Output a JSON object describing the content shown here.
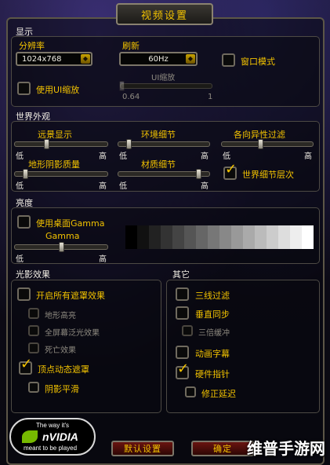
{
  "window": {
    "title": "视频设置"
  },
  "display": {
    "section_label": "显示",
    "resolution_label": "分辨率",
    "resolution_value": "1024x768",
    "refresh_label": "刷新",
    "refresh_value": "60Hz",
    "window_mode_label": "窗口模式",
    "window_mode_checked": false,
    "ui_scale_label": "使用UI缩放",
    "ui_scale_checked": false,
    "ui_scale_slider_label": "UI缩放",
    "ui_scale_min": "0.64",
    "ui_scale_max": "1",
    "ui_scale_level": 0.0
  },
  "world": {
    "section_label": "世界外观",
    "low_label": "低",
    "high_label": "高",
    "view_distance_label": "远景显示",
    "view_distance_level": 0.33,
    "environment_detail_label": "环境细节",
    "environment_detail_level": 0.11,
    "aniso_label": "各向异性过滤",
    "aniso_level": 0.42,
    "terrain_shadow_label": "地形阴影质量",
    "terrain_shadow_level": 0.1,
    "texture_detail_label": "材质细节",
    "texture_detail_level": 0.88,
    "world_lod_label": "世界细节层次",
    "world_lod_checked": true
  },
  "brightness": {
    "section_label": "亮度",
    "desktop_gamma_label": "使用桌面Gamma",
    "desktop_gamma_checked": false,
    "gamma_label": "Gamma",
    "gamma_level": 0.5,
    "low_label": "低",
    "high_label": "高"
  },
  "lighting": {
    "section_label": "光影效果",
    "enable_all_label": "开启所有遮罩效果",
    "enable_all_checked": false,
    "terrain_highlight_label": "地形高亮",
    "fullscreen_glow_label": "全屏幕泛光效果",
    "death_effect_label": "死亡效果",
    "vertex_shader_label": "顶点动态遮罩",
    "vertex_shader_checked": true,
    "shadow_smoothing_label": "阴影平滑"
  },
  "other": {
    "section_label": "其它",
    "trilinear_label": "三线过滤",
    "vsync_label": "垂直同步",
    "triple_buffer_label": "三倍缓冲",
    "animated_text_label": "动画字幕",
    "hardware_cursor_label": "硬件指针",
    "hardware_cursor_checked": true,
    "fix_lag_label": "修正延迟"
  },
  "footer": {
    "nvidia_top": "The way it's",
    "nvidia_brand": "nVIDIA",
    "nvidia_bottom": "meant to be played",
    "defaults_button": "默认设置",
    "ok_button": "确定"
  },
  "watermark": "维普手游网",
  "colors": {
    "accent": "#f2c200",
    "frame": "#5c5647",
    "button": "#6a1410"
  }
}
